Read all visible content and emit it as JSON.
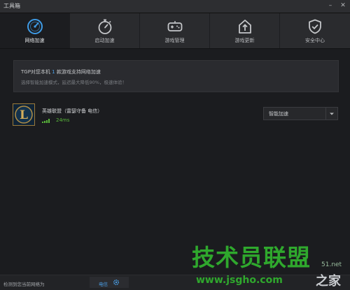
{
  "window": {
    "title": "工具箱",
    "controls": [
      "minimize-icon",
      "close-icon"
    ]
  },
  "tabs": [
    {
      "label": "网络加速",
      "icon": "speedometer-icon",
      "active": true
    },
    {
      "label": "启动加速",
      "icon": "stopwatch-icon",
      "active": false
    },
    {
      "label": "游戏管理",
      "icon": "gamepad-icon",
      "active": false
    },
    {
      "label": "游戏更新",
      "icon": "update-icon",
      "active": false
    },
    {
      "label": "安全中心",
      "icon": "shield-check-icon",
      "active": false
    }
  ],
  "notice": {
    "prefix": "TGP对您本机",
    "count": "1",
    "suffix": "款游戏支持网络加速",
    "hint": "选择智能加速模式，延迟最大降低90%，极速体验！"
  },
  "game": {
    "name": "英雄联盟（雷瑟守备 电信）",
    "logo_letter": "L",
    "ping": "24ms",
    "mode": "智能加速"
  },
  "status": {
    "label": "检测到您当前网络为",
    "isp": "电信"
  },
  "watermark": {
    "brand": "技术员联盟",
    "num": "51.net",
    "url": "www.jsgho.com",
    "zhi": "之家"
  },
  "colors": {
    "accent": "#4aa0e8",
    "ping_green": "#59b83a",
    "watermark_green": "#2fa82d"
  }
}
